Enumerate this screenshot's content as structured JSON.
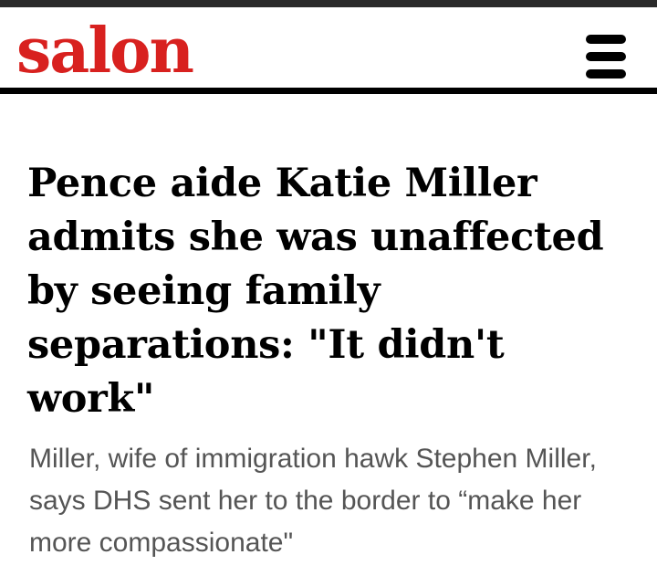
{
  "header": {
    "logo_text": "salon",
    "menu_icon": "hamburger-menu-icon"
  },
  "article": {
    "headline": "Pence aide Katie Miller admits she was unaffected by seeing family separations: \"It didn't work\"",
    "subhead": "Miller, wife of immigration hawk Stephen Miller, says DHS sent her to the border to “make her more compassionate\""
  },
  "colors": {
    "brand_red": "#d8211f",
    "text": "#000000",
    "subtext": "#555555"
  }
}
